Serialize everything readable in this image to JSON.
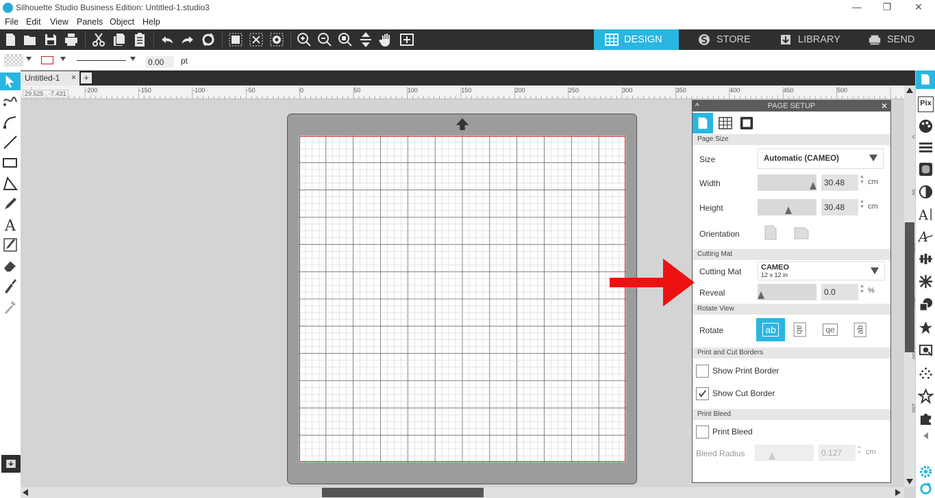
{
  "window": {
    "title": "Silhouette Studio Business Edition: Untitled-1.studio3",
    "minimize": "—",
    "restore": "❐",
    "close": "✕"
  },
  "menu": [
    "File",
    "Edit",
    "View",
    "Panels",
    "Object",
    "Help"
  ],
  "nav_tabs": [
    {
      "label": "DESIGN",
      "icon": "grid-icon",
      "active": true
    },
    {
      "label": "STORE",
      "icon": "store-icon",
      "active": false
    },
    {
      "label": "LIBRARY",
      "icon": "library-icon",
      "active": false
    },
    {
      "label": "SEND",
      "icon": "send-icon",
      "active": false
    }
  ],
  "toolbar_icons": [
    "new-icon",
    "open-icon",
    "save-icon",
    "print-icon",
    "cut-icon",
    "copy-icon",
    "paste-icon",
    "undo-icon",
    "redo-icon",
    "refresh-icon",
    "group-icon",
    "ungroup-icon",
    "compound-icon",
    "zoom-in-icon",
    "zoom-out-icon",
    "zoom-select-icon",
    "fit-page-icon",
    "pan-hand-icon",
    "fit-view-icon"
  ],
  "property_bar": {
    "line_width": "0.00",
    "unit": "pt"
  },
  "document_tab": {
    "name": "Untitled-1",
    "close": "×",
    "add": "+"
  },
  "cursor_coords": "29.525 , -7.431",
  "ruler": {
    "top_labels": [
      "-200",
      "-150",
      "-100",
      "-50",
      "0",
      "50",
      "100",
      "150",
      "200",
      "250",
      "300",
      "350",
      "400",
      "450",
      "500"
    ],
    "right_labels": [
      "0",
      "50",
      "100",
      "150",
      "200",
      "250"
    ]
  },
  "page_setup": {
    "title": "PAGE SETUP",
    "collapse": "^",
    "close": "✕",
    "sections": {
      "page_size": "Page Size",
      "cutting_mat": "Cutting Mat",
      "rotate_view": "Rotate View",
      "borders": "Print and Cut Borders",
      "print_bleed": "Print Bleed"
    },
    "size_label": "Size",
    "size_value": "Automatic (CAMEO)",
    "width_label": "Width",
    "width_value": "30.48",
    "width_unit": "cm",
    "height_label": "Height",
    "height_value": "30.48",
    "height_unit": "cm",
    "orientation_label": "Orientation",
    "cutting_mat_label": "Cutting Mat",
    "cutting_mat_value": "CAMEO",
    "cutting_mat_sub": "12 x 12 in",
    "reveal_label": "Reveal",
    "reveal_value": "0.0",
    "reveal_unit": "%",
    "rotate_label": "Rotate",
    "rotate_options": [
      "ab",
      "ab",
      "qe",
      "ab"
    ],
    "show_print_border": "Show Print Border",
    "show_print_border_checked": false,
    "show_cut_border": "Show Cut Border",
    "show_cut_border_checked": true,
    "print_bleed": "Print Bleed",
    "print_bleed_checked": false,
    "bleed_radius_label": "Bleed Radius",
    "bleed_radius_value": "0.127",
    "bleed_radius_unit": "cm"
  },
  "right_toolbar": {
    "pix_label": "Pix"
  },
  "colors": {
    "accent": "#29b6e0",
    "toolbar_bg": "#2f2f2f",
    "annotation_arrow": "#ee1111"
  }
}
